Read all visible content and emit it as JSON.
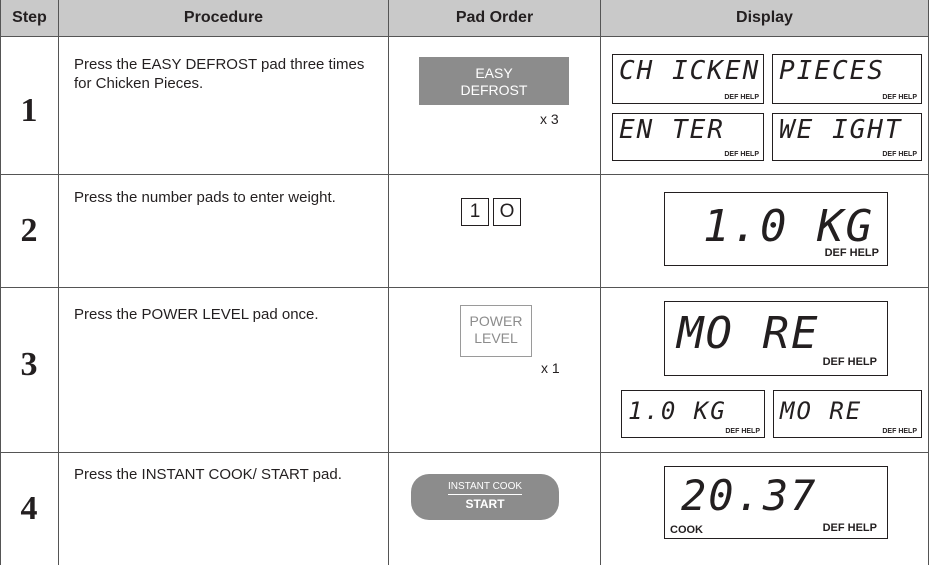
{
  "headers": {
    "step": "Step",
    "procedure": "Procedure",
    "pad_order": "Pad Order",
    "display": "Display"
  },
  "rows": [
    {
      "step": "1",
      "procedure": "Press the EASY DEFROST pad three times for Chicken Pieces.",
      "pad": {
        "line1": "EASY",
        "line2": "DEFROST",
        "multiplier": "x 3"
      },
      "displays": [
        {
          "text": "CH ICKEN",
          "sub": "DEF HELP"
        },
        {
          "text": "PIECES",
          "sub": "DEF HELP"
        },
        {
          "text": "EN TER",
          "sub": "DEF HELP"
        },
        {
          "text": "WE IGHT",
          "sub": "DEF HELP"
        }
      ]
    },
    {
      "step": "2",
      "procedure": "Press the number pads to enter weight.",
      "pads": [
        "1",
        "O"
      ],
      "display": {
        "text": "1.0 KG",
        "sub": "DEF HELP"
      }
    },
    {
      "step": "3",
      "procedure": "Press the POWER LEVEL pad once.",
      "pad": {
        "line1": "POWER",
        "line2": "LEVEL",
        "multiplier": "x 1"
      },
      "display_main": {
        "text": "MO RE",
        "sub": "DEF HELP"
      },
      "displays": [
        {
          "text": "1.0 KG",
          "sub": "DEF HELP"
        },
        {
          "text": "MO RE",
          "sub": "DEF HELP"
        }
      ]
    },
    {
      "step": "4",
      "procedure": "Press the INSTANT COOK/ START pad.",
      "pad": {
        "line1": "INSTANT COOK",
        "line2": "START"
      },
      "display": {
        "text": "20.37",
        "sub_left": "COOK",
        "sub": "DEF HELP"
      }
    }
  ]
}
